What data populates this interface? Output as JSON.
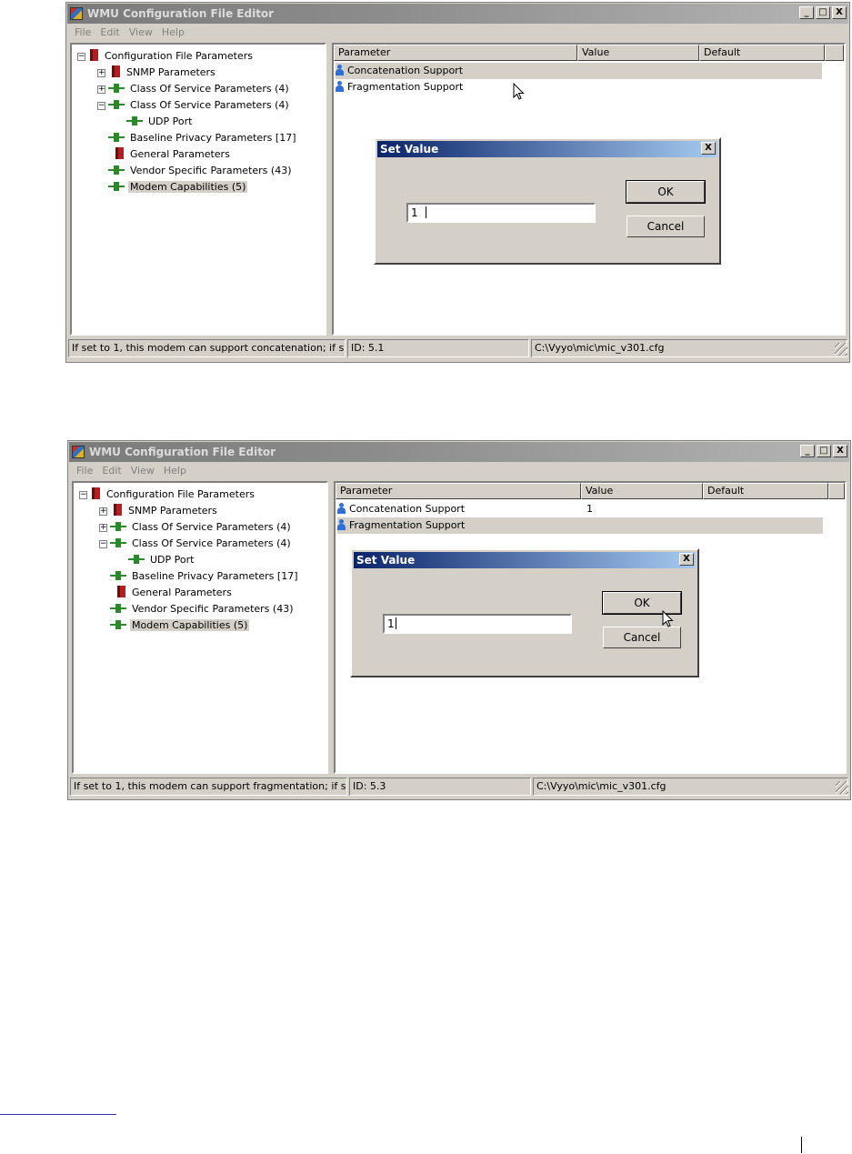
{
  "app_title": "WMU Configuration File Editor",
  "menu": [
    "File",
    "Edit",
    "View",
    "Help"
  ],
  "window_buttons": [
    "_",
    "□",
    "X"
  ],
  "tree": [
    {
      "label": "Configuration File Parameters",
      "icon": "book-icon",
      "expander": "−"
    },
    {
      "label": "SNMP Parameters",
      "icon": "book-icon",
      "expander": "+"
    },
    {
      "label": "Class Of Service Parameters (4)",
      "icon": "plug-icon",
      "expander": "+"
    },
    {
      "label": "Class Of Service Parameters (4)",
      "icon": "plug-icon",
      "expander": "−"
    },
    {
      "label": "UDP Port",
      "icon": "plug-icon"
    },
    {
      "label": "Baseline Privacy Parameters [17]",
      "icon": "plug-icon"
    },
    {
      "label": "General Parameters",
      "icon": "book-icon"
    },
    {
      "label": "Vendor Specific Parameters (43)",
      "icon": "plug-icon"
    },
    {
      "label": "Modem Capabilities (5)",
      "icon": "plug-icon",
      "selected": true
    }
  ],
  "columns": [
    "Parameter",
    "Value",
    "Default"
  ],
  "screens": [
    {
      "rows": [
        {
          "name": "Concatenation Support",
          "value": ""
        },
        {
          "name": "Fragmentation Support",
          "value": ""
        }
      ],
      "dialog": {
        "title": "Set Value",
        "close": "X",
        "input_value": "1",
        "ok": "OK",
        "cancel": "Cancel"
      },
      "status": {
        "message": "If set to 1, this modem can support concatenation; if s",
        "id": "ID: 5.1",
        "path": "C:\\Vyyo\\mic\\mic_v301.cfg"
      }
    },
    {
      "rows": [
        {
          "name": "Concatenation Support",
          "value": "1"
        },
        {
          "name": "Fragmentation Support",
          "value": ""
        }
      ],
      "dialog": {
        "title": "Set Value",
        "close": "X",
        "input_value": "1",
        "ok": "OK",
        "cancel": "Cancel"
      },
      "status": {
        "message": "If set to 1, this modem can support fragmentation; if s",
        "id": "ID: 5.3",
        "path": "C:\\Vyyo\\mic\\mic_v301.cfg"
      }
    }
  ]
}
